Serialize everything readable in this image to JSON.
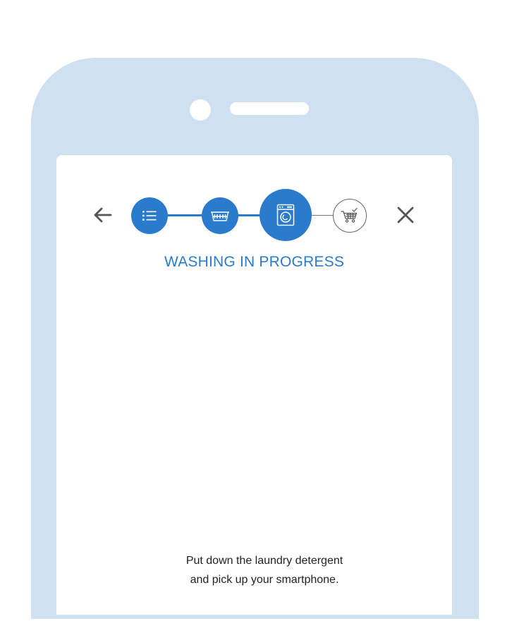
{
  "header": {
    "step_title": "WASHING IN PROGRESS"
  },
  "navigation": {
    "back_icon": "arrow-left-icon",
    "close_icon": "close-icon"
  },
  "stepper": {
    "steps": [
      {
        "icon": "list-icon",
        "state": "done"
      },
      {
        "icon": "laundry-basket-icon",
        "state": "done"
      },
      {
        "icon": "washing-machine-icon",
        "state": "active"
      },
      {
        "icon": "cart-check-icon",
        "state": "pending"
      }
    ]
  },
  "instruction": {
    "line1": "Put down the laundry detergent",
    "line2": "and pick up your smartphone."
  },
  "colors": {
    "accent": "#2a7bcc",
    "phone_frame": "#cfe0f1",
    "icon_gray": "#555555"
  }
}
